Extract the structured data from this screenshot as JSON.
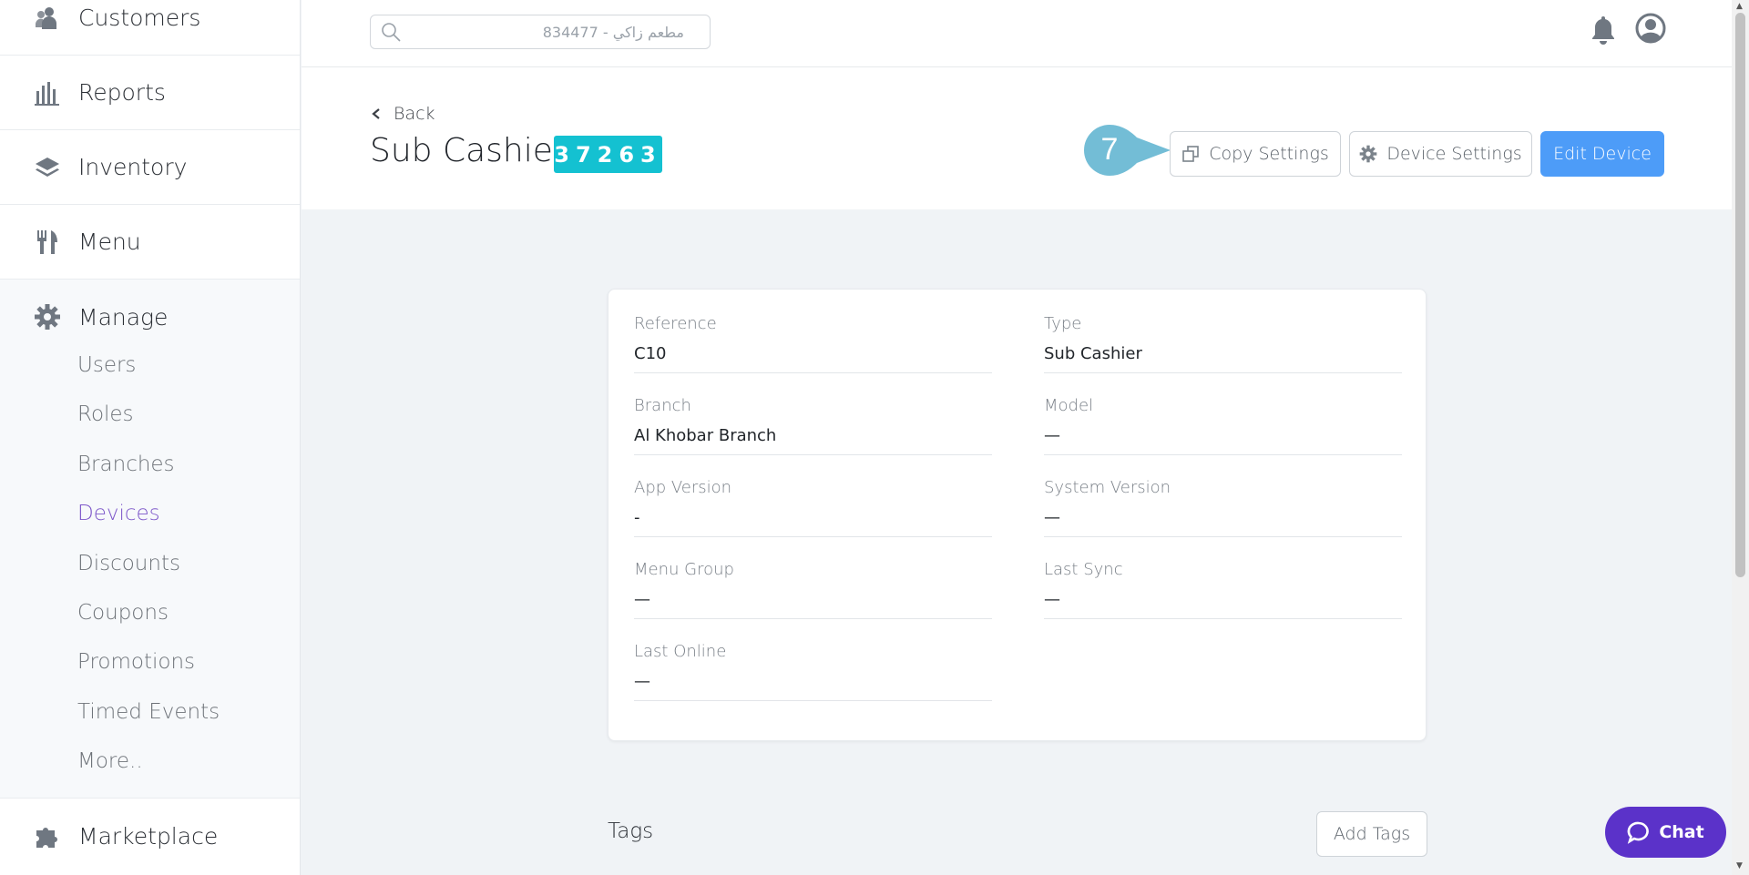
{
  "sidebar": {
    "items": [
      {
        "label": "Customers",
        "icon": "customers-icon"
      },
      {
        "label": "Reports",
        "icon": "reports-icon"
      },
      {
        "label": "Inventory",
        "icon": "inventory-icon"
      },
      {
        "label": "Menu",
        "icon": "menu-icon"
      }
    ],
    "manage": {
      "label": "Manage",
      "icon": "gear-icon",
      "subitems": [
        "Users",
        "Roles",
        "Branches",
        "Devices",
        "Discounts",
        "Coupons",
        "Promotions",
        "Timed Events",
        "More.."
      ],
      "active": "Devices"
    },
    "marketplace": {
      "label": "Marketplace",
      "icon": "puzzle-icon"
    }
  },
  "topbar": {
    "search_placeholder": "مطعم زاكي - 834477"
  },
  "header": {
    "back_label": "Back",
    "title": "Sub Cashier",
    "reference_badge": "37263",
    "step_number": "7",
    "copy_settings_label": "Copy Settings",
    "device_settings_label": "Device Settings",
    "edit_device_label": "Edit Device"
  },
  "details": {
    "reference": {
      "label": "Reference",
      "value": "C10"
    },
    "type": {
      "label": "Type",
      "value": "Sub Cashier"
    },
    "branch": {
      "label": "Branch",
      "value": "Al Khobar Branch"
    },
    "model": {
      "label": "Model",
      "value": "—"
    },
    "app_version": {
      "label": "App Version",
      "value": "-"
    },
    "system_version": {
      "label": "System Version",
      "value": "—"
    },
    "menu_group": {
      "label": "Menu Group",
      "value": "—"
    },
    "last_sync": {
      "label": "Last Sync",
      "value": "—"
    },
    "last_online": {
      "label": "Last Online",
      "value": "—"
    }
  },
  "tags": {
    "title": "Tags",
    "add_label": "Add Tags"
  },
  "chat": {
    "label": "Chat"
  },
  "colors": {
    "accent_purple": "#7c56c9",
    "badge_teal": "#14c1d1",
    "primary_blue": "#4d9cf8",
    "chat_purple": "#5b32c9",
    "step_marker": "#73bdd6"
  }
}
